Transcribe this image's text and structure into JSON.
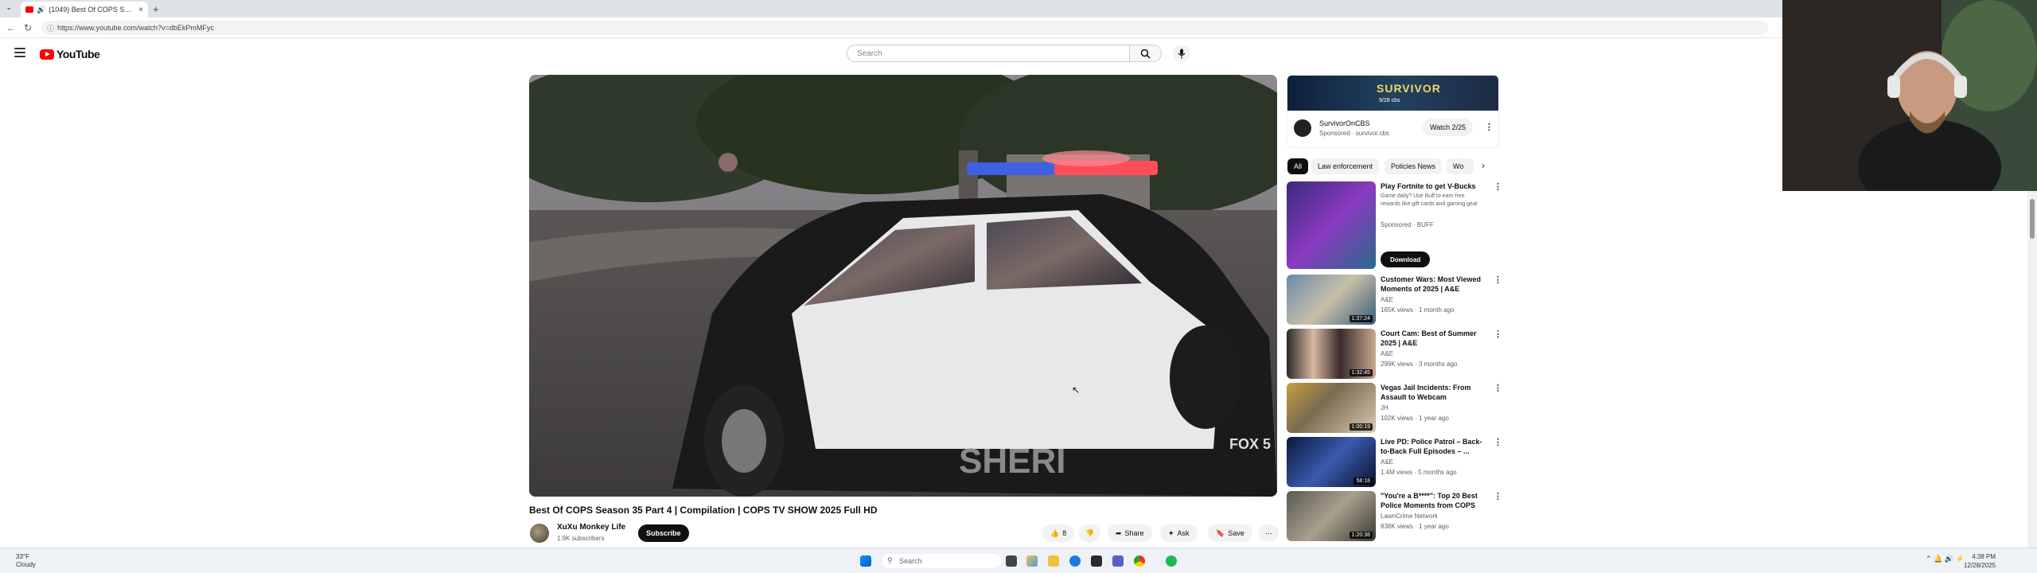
{
  "browser": {
    "tab_title": "(1049) Best Of COPS Season",
    "url": "https://www.youtube.com/watch?v=dbEkPmMFyc"
  },
  "youtube": {
    "logo_text": "YouTube",
    "search_placeholder": "Search"
  },
  "video": {
    "title": "Best Of COPS Season 35 Part 4 | Compilation | COPS TV SHOW 2025 Full HD",
    "channel": "XuXu Monkey Life",
    "subscribers": "1.9K subscribers",
    "subscribe_label": "Subscribe",
    "likes": "8",
    "share_label": "Share",
    "ask_label": "Ask",
    "save_label": "Save",
    "overlay_text": "SHERI",
    "channel_bug": "FOX 5"
  },
  "ad": {
    "banner_title": "SURVIVOR",
    "banner_sub": "9/28 cbs",
    "name": "SurvivorOnCBS",
    "sponsored": "Sponsored · survivor.cbs",
    "watch_label": "Watch 2/25"
  },
  "chips": [
    "All",
    "Law enforcement",
    "Policies News",
    "Wo"
  ],
  "recommendations": [
    {
      "title": "Play Fortnite to get V-Bucks",
      "channel": "Game daily? Use Buff to earn free rewards like gift cards and gaming gear",
      "meta": "Sponsored · BUFF",
      "duration": "",
      "download_label": "Download"
    },
    {
      "title": "Customer Wars: Most Viewed Moments of 2025 | A&E",
      "channel": "A&E",
      "meta": "165K views · 1 month ago",
      "duration": "1:37:24"
    },
    {
      "title": "Court Cam: Best of Summer 2025 | A&E",
      "channel": "A&E",
      "meta": "299K views · 3 months ago",
      "duration": "1:32:45"
    },
    {
      "title": "Vegas Jail Incidents: From Assault to Webcam Revelation...",
      "channel": "JH",
      "meta": "102K views · 1 year ago",
      "duration": "1:00:19"
    },
    {
      "title": "Live PD: Police Patrol – Back-to-Back Full Episodes – ...",
      "channel": "A&E",
      "meta": "1.4M views · 5 months ago",
      "duration": "58:18"
    },
    {
      "title": "\"You're a B****\": Top 20 Best Police Moments from COPS",
      "channel": "LawnCrime Network",
      "meta": "838K views · 1 year ago",
      "duration": "1:20:38"
    }
  ],
  "taskbar": {
    "weather_temp": "33°F",
    "weather_desc": "Cloudy",
    "search_label": "Search",
    "time": "4:38 PM",
    "date": "12/28/2025"
  },
  "colors": {
    "youtube_red": "#ff0000",
    "text": "#0f0f0f",
    "secondary": "#606060"
  }
}
